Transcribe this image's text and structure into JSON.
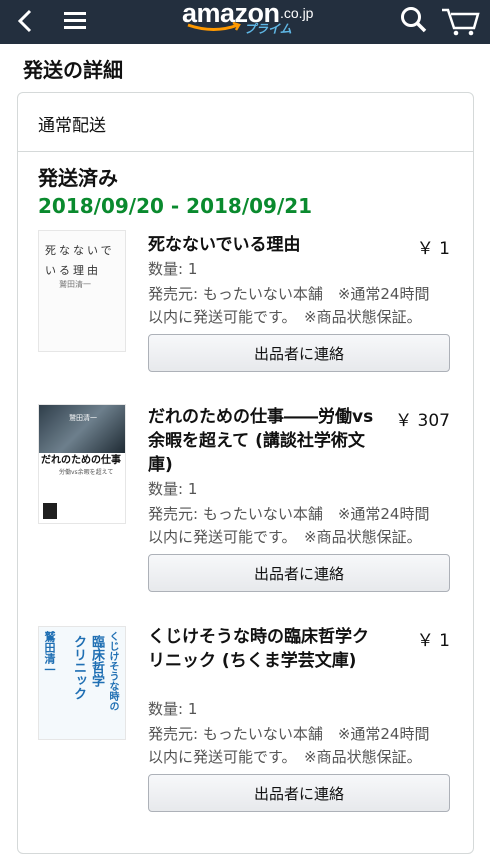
{
  "header": {
    "logo_text": "amazon",
    "logo_domain": ".co.jp",
    "logo_sub": "プライム",
    "icons": [
      "back-icon",
      "menu-icon",
      "search-icon",
      "cart-icon"
    ],
    "colors": {
      "bar": "#232f3e",
      "accent": "#ff9900"
    }
  },
  "page": {
    "title": "発送の詳細"
  },
  "shipment": {
    "method": "通常配送",
    "status": "発送済み",
    "delivery_range": "2018/09/20 - 2018/09/21",
    "delivery_color": "#0a8a2e",
    "items": [
      {
        "title": "死なないでいる理由",
        "price": "￥ 1",
        "quantity": "数量: 1",
        "seller_line1": "発売元: もったいない本舗　※通常24時間",
        "seller_line2": "以内に発送可能です。　※商品状態保証。",
        "button": "出品者に連絡",
        "cover": {
          "vertical_text": "死なないでいる理由",
          "author": "鷲田清一"
        }
      },
      {
        "title": "だれのための仕事――労働vs余暇を超えて (講談社学術文庫)",
        "price": "￥ 307",
        "quantity": "数量: 1",
        "seller_line1": "発売元: もったいない本舗　※通常24時間",
        "seller_line2": "以内に発送可能です。　※商品状態保証。",
        "button": "出品者に連絡",
        "cover": {
          "title": "だれのための仕事",
          "subtitle": "労働vs余暇を超えて",
          "author": "鷲田清一"
        }
      },
      {
        "title": "くじけそうな時の臨床哲学クリニック (ちくま学芸文庫)",
        "price": "￥ 1",
        "quantity": "数量: 1",
        "seller_line1": "発売元: もったいない本舗　※通常24時間",
        "seller_line2": "以内に発送可能です。　※商品状態保証。",
        "button": "出品者に連絡",
        "cover": {
          "author": "鷲田清一",
          "col_a": "くじけそうな時の",
          "col_b": "臨床哲学",
          "col_c": "クリニック"
        }
      }
    ]
  }
}
